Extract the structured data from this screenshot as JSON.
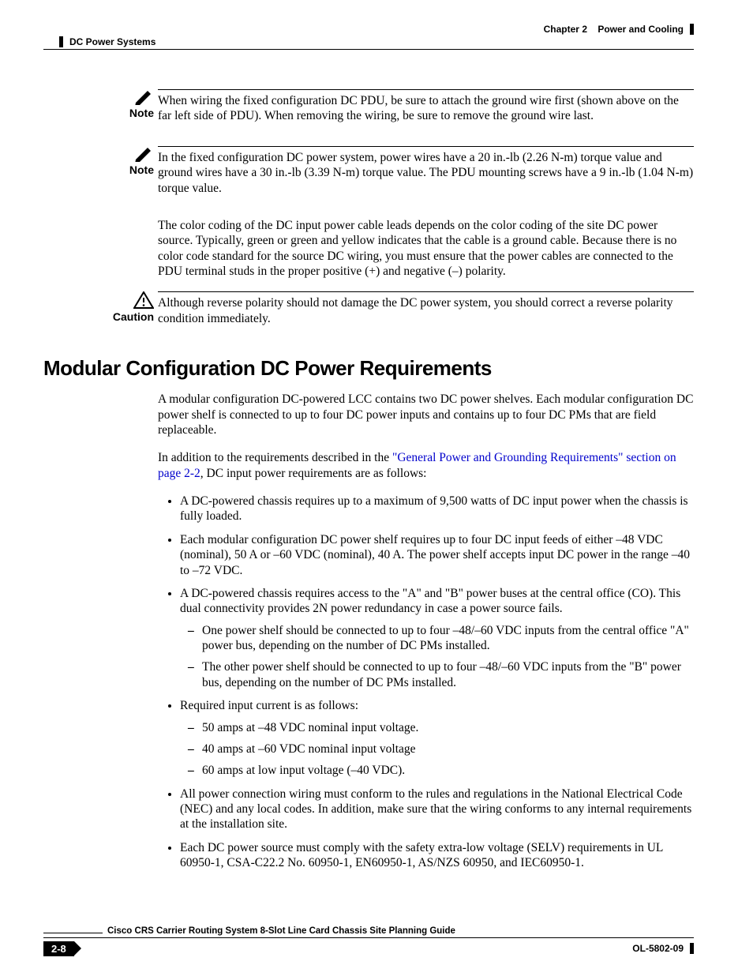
{
  "header": {
    "chapter": "Chapter 2    Power and Cooling",
    "section": "DC Power Systems"
  },
  "notes": {
    "n1_label": "Note",
    "n1_body": "When wiring the fixed configuration DC PDU, be sure to attach the ground wire first (shown above on the far left side of PDU). When removing the wiring, be sure to remove the ground wire last.",
    "n2_label": "Note",
    "n2_body": "In the fixed configuration DC power system, power wires have a 20 in.-lb (2.26 N-m) torque value and ground wires have a 30 in.-lb (3.39 N-m) torque value. The PDU mounting screws have a 9 in.-lb (1.04 N-m) torque value.",
    "color_para": "The color coding of the DC input power cable leads depends on the color coding of the site DC power source. Typically, green or green and yellow indicates that the cable is a ground cable. Because there is no color code standard for the source DC wiring, you must ensure that the power cables are connected to the PDU terminal studs in the proper positive (+) and negative (–) polarity.",
    "caution_label": "Caution",
    "caution_body": "Although reverse polarity should not damage the DC power system, you should correct a reverse polarity condition immediately."
  },
  "section": {
    "heading": "Modular Configuration DC Power Requirements",
    "p1": "A modular configuration DC-powered LCC contains two DC power shelves. Each modular configuration DC power shelf is connected to up to four DC power inputs and contains up to four DC PMs that are field replaceable.",
    "p2a": "In addition to the requirements described in the ",
    "p2link": "\"General Power and Grounding Requirements\" section on page 2-2",
    "p2b": ", DC input power requirements are as follows:",
    "bullets": {
      "b1": "A DC-powered chassis requires up to a maximum of 9,500 watts of DC input power when the chassis is fully loaded.",
      "b2": "Each modular configuration DC power shelf requires up to four DC input feeds of either –48 VDC (nominal), 50 A or –60 VDC (nominal), 40 A. The power shelf accepts input DC power in the range –40 to –72 VDC.",
      "b3": "A DC-powered chassis requires access to the \"A\" and \"B\" power buses at the central office (CO). This dual connectivity provides 2N power redundancy in case a power source fails.",
      "b3s1": "One power shelf should be connected to up to four –48/–60 VDC inputs from the central office \"A\" power bus, depending on the number of DC PMs installed.",
      "b3s2": "The other power shelf should be connected to up to four  –48/–60 VDC inputs from the \"B\" power bus, depending on the number of DC PMs installed.",
      "b4": "Required input current is as follows:",
      "b4s1": "50 amps at –48 VDC nominal input voltage.",
      "b4s2": "40 amps at –60 VDC nominal input voltage",
      "b4s3": "60 amps at low input voltage (–40 VDC).",
      "b5": "All power connection wiring must conform to the rules and regulations in the National Electrical Code (NEC) and any local codes. In addition, make sure that the wiring conforms to any internal requirements at the installation site.",
      "b6": "Each DC power source must comply with the safety extra-low voltage (SELV) requirements in UL 60950-1, CSA-C22.2 No. 60950-1, EN60950-1, AS/NZS 60950, and IEC60950-1."
    }
  },
  "footer": {
    "title": "Cisco CRS Carrier Routing System 8-Slot Line Card Chassis Site Planning Guide",
    "page": "2-8",
    "docid": "OL-5802-09"
  }
}
